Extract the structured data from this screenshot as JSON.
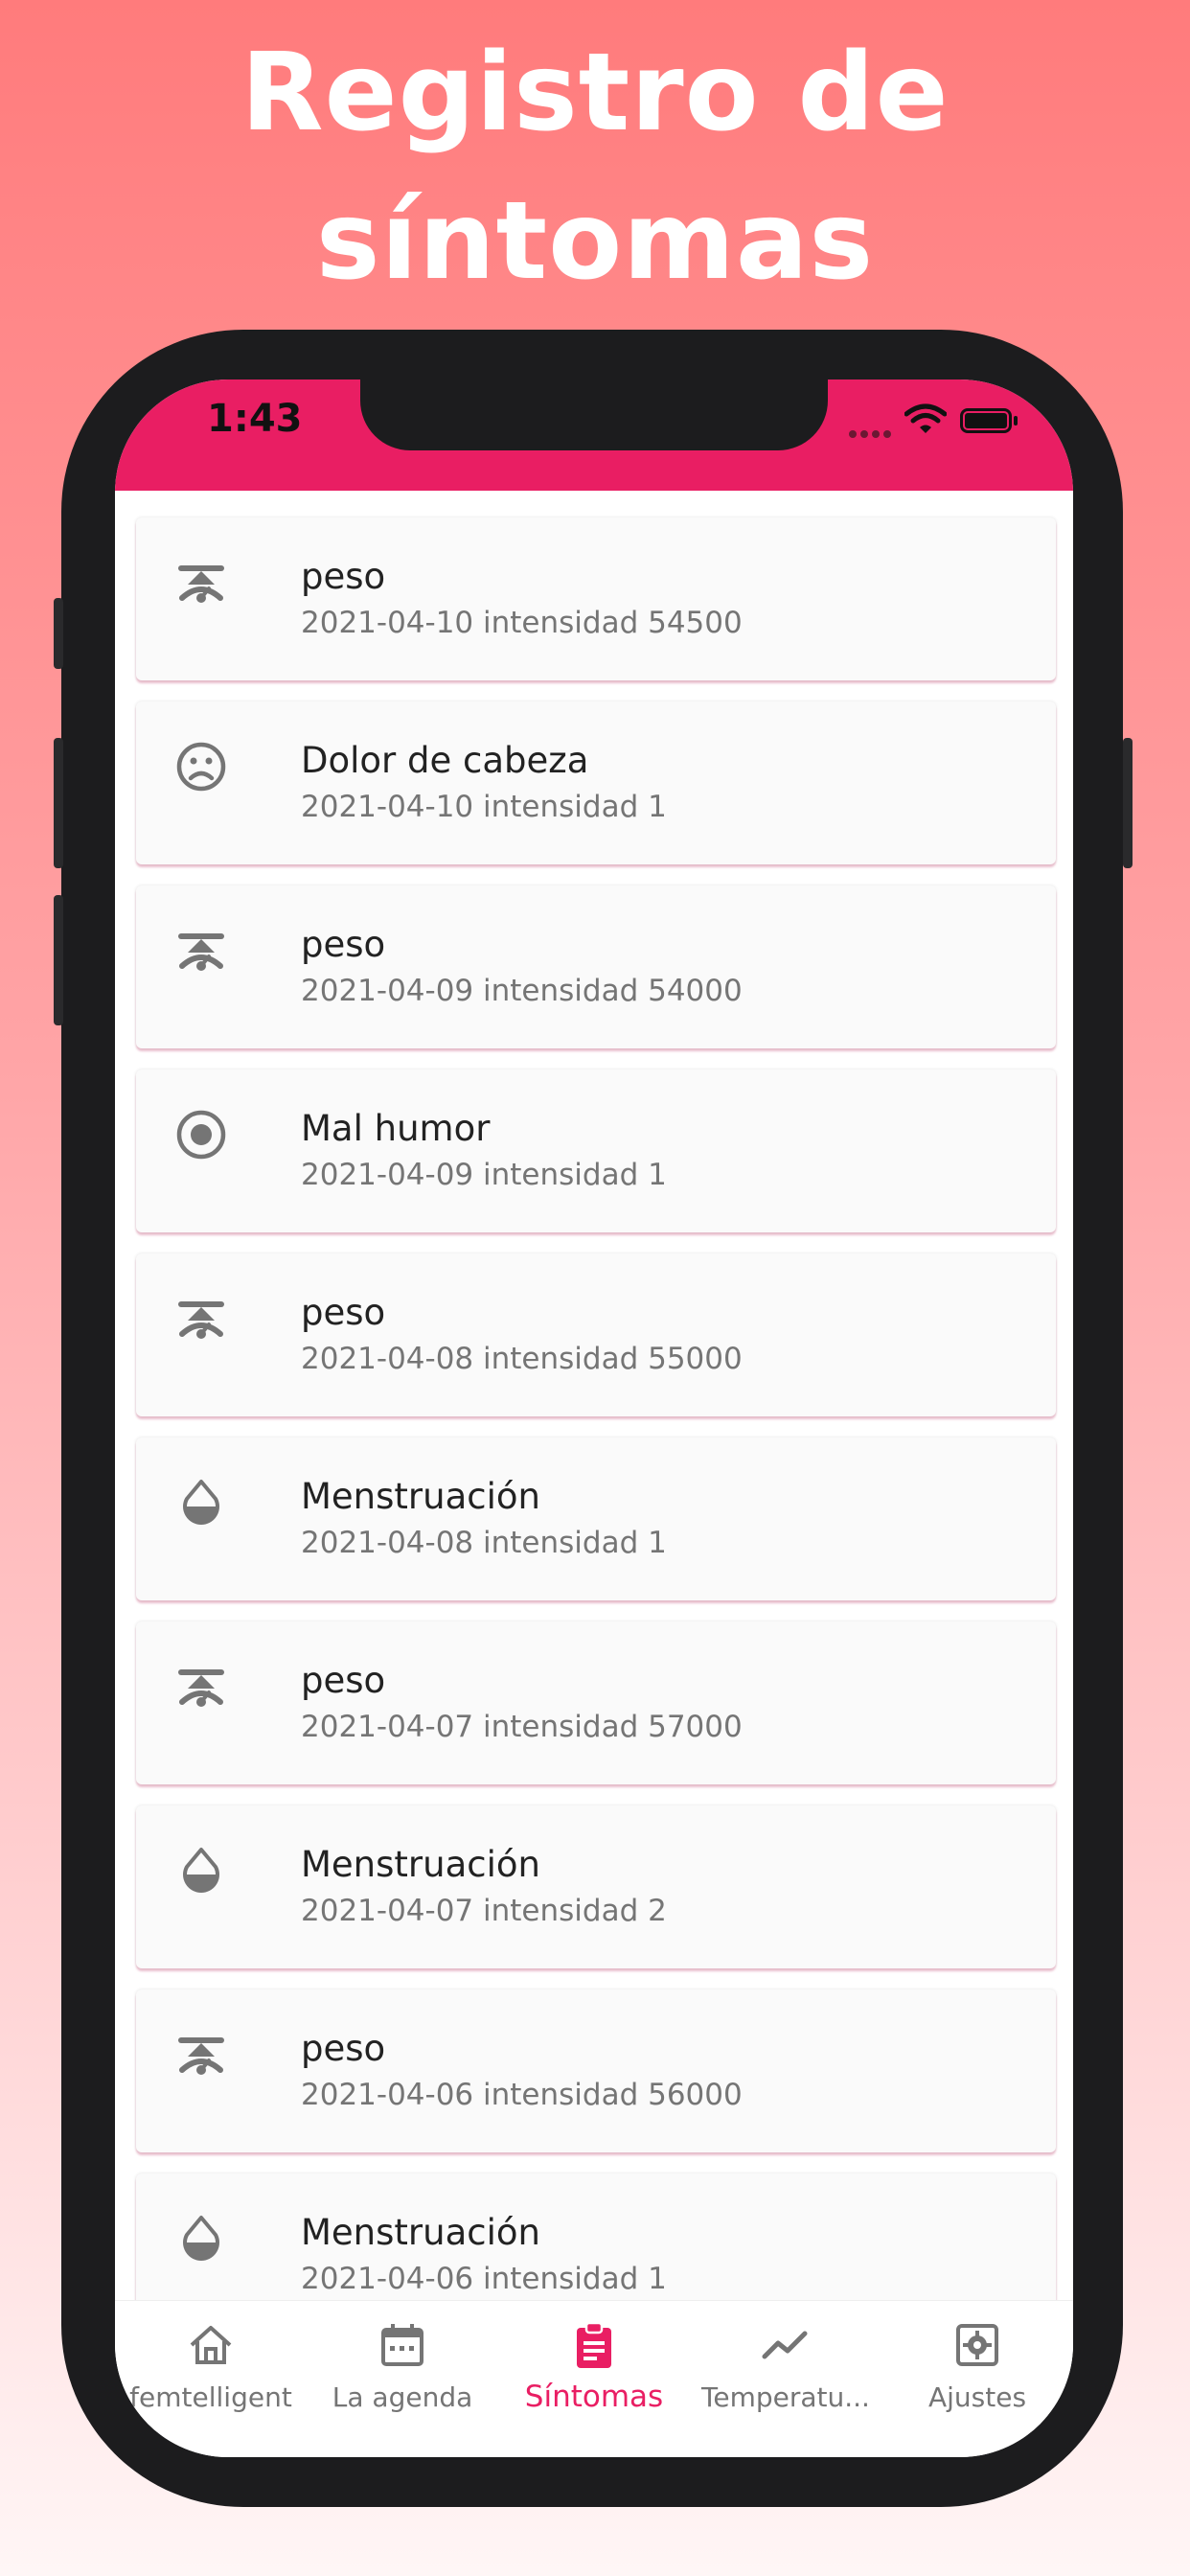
{
  "headline": {
    "line1": "Registro de",
    "line2": "síntomas"
  },
  "status_bar": {
    "time": "1:43"
  },
  "colors": {
    "accent": "#e91e63",
    "icon_gray": "#757575",
    "phone_frame": "#1c1c1e"
  },
  "symptoms": [
    {
      "icon": "scale-icon",
      "name": "peso",
      "detail": "2021-04-10 intensidad 54500"
    },
    {
      "icon": "sad-face-icon",
      "name": "Dolor de cabeza",
      "detail": "2021-04-10 intensidad 1"
    },
    {
      "icon": "scale-icon",
      "name": "peso",
      "detail": "2021-04-09 intensidad 54000"
    },
    {
      "icon": "radio-target-icon",
      "name": "Mal humor",
      "detail": "2021-04-09 intensidad 1"
    },
    {
      "icon": "scale-icon",
      "name": "peso",
      "detail": "2021-04-08 intensidad 55000"
    },
    {
      "icon": "drop-icon",
      "name": "Menstruación",
      "detail": "2021-04-08 intensidad 1"
    },
    {
      "icon": "scale-icon",
      "name": "peso",
      "detail": "2021-04-07 intensidad 57000"
    },
    {
      "icon": "drop-icon",
      "name": "Menstruación",
      "detail": "2021-04-07 intensidad 2"
    },
    {
      "icon": "scale-icon",
      "name": "peso",
      "detail": "2021-04-06 intensidad 56000"
    },
    {
      "icon": "drop-icon",
      "name": "Menstruación",
      "detail": "2021-04-06 intensidad 1"
    }
  ],
  "nav": [
    {
      "icon": "home-icon",
      "label": "femtelligent",
      "active": false
    },
    {
      "icon": "calendar-icon",
      "label": "La agenda",
      "active": false
    },
    {
      "icon": "clipboard-icon",
      "label": "Síntomas",
      "active": true
    },
    {
      "icon": "trend-line-icon",
      "label": "Temperatu...",
      "active": false
    },
    {
      "icon": "settings-icon",
      "label": "Ajustes",
      "active": false
    }
  ]
}
